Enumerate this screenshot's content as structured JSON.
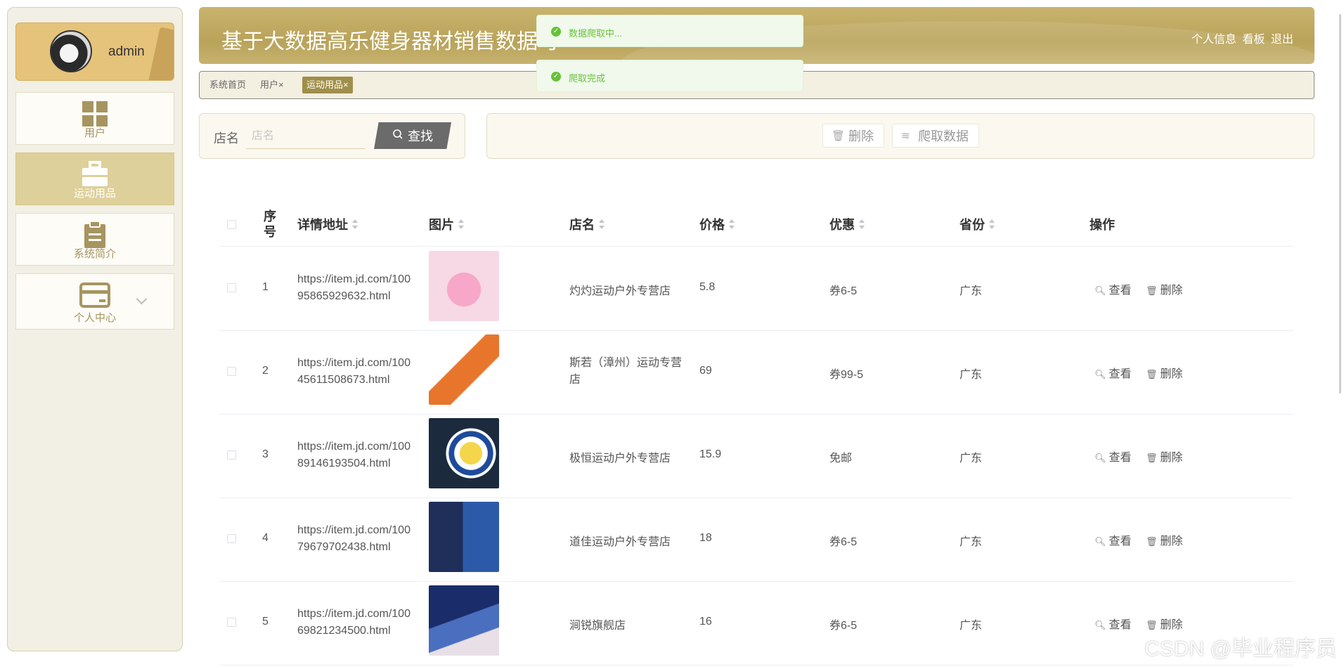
{
  "sidebar": {
    "user_name": "admin",
    "items": [
      {
        "label": "用户",
        "icon": "grid-icon"
      },
      {
        "label": "运动用品",
        "icon": "briefcase-icon"
      },
      {
        "label": "系统简介",
        "icon": "clipboard-icon"
      },
      {
        "label": "个人中心",
        "icon": "wallet-icon"
      }
    ]
  },
  "header": {
    "title": "基于大数据高乐健身器材销售数据可",
    "links": [
      "个人信息",
      "看板",
      "退出"
    ]
  },
  "tabs": [
    {
      "label": "系统首页"
    },
    {
      "label": "用户×"
    },
    {
      "label": "运动用品×"
    }
  ],
  "toasts": [
    {
      "message": "数据爬取中..."
    },
    {
      "message": "爬取完成"
    }
  ],
  "search": {
    "label": "店名",
    "placeholder": "店名",
    "button": "查找"
  },
  "actions": {
    "delete": "删除",
    "crawl": "爬取数据"
  },
  "table": {
    "headers": {
      "index": "序号",
      "url": "详情地址",
      "image": "图片",
      "shop": "店名",
      "price": "价格",
      "discount": "优惠",
      "province": "省份",
      "ops": "操作"
    },
    "view_label": "查看",
    "delete_label": "删除",
    "rows": [
      {
        "index": "1",
        "url": "https://item.jd.com/10095865929632.html",
        "shop": "灼灼运动户外专营店",
        "price": "5.8",
        "discount": "券6-5",
        "province": "广东"
      },
      {
        "index": "2",
        "url": "https://item.jd.com/10045611508673.html",
        "shop": "斯若（漳州）运动专营店",
        "price": "69",
        "discount": "券99-5",
        "province": "广东"
      },
      {
        "index": "3",
        "url": "https://item.jd.com/10089146193504.html",
        "shop": "极恒运动户外专营店",
        "price": "15.9",
        "discount": "免邮",
        "province": "广东"
      },
      {
        "index": "4",
        "url": "https://item.jd.com/10079679702438.html",
        "shop": "道佳运动户外专营店",
        "price": "18",
        "discount": "券6-5",
        "province": "广东"
      },
      {
        "index": "5",
        "url": "https://item.jd.com/10069821234500.html",
        "shop": "涧锐旗舰店",
        "price": "16",
        "discount": "券6-5",
        "province": "广东"
      }
    ]
  },
  "watermark": "CSDN @毕业程序员",
  "colors": {
    "accent": "#b9a35a",
    "active_tab": "#a08f4a",
    "toast_green": "#67c23a",
    "sidebar_active": "#ddd09a"
  }
}
